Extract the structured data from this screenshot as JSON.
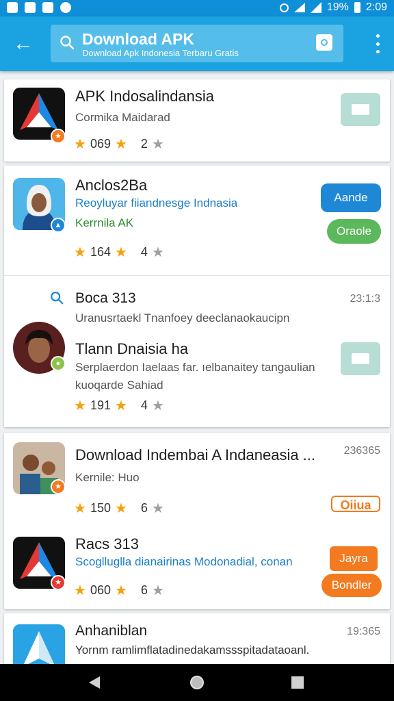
{
  "status_bar": {
    "battery": "19%",
    "time": "2:09"
  },
  "app_bar": {
    "search_title": "Download APK",
    "search_subtitle": "Download Apk Indonesia Terbaru Gratis"
  },
  "colors": {
    "accent": "#1aa3e0",
    "blue_button": "#1e88d6",
    "green_button": "#5cb85c",
    "orange_button": "#f37a1f",
    "star": "#f5a10a"
  },
  "list": [
    {
      "title": "APK Indosalindansia",
      "subtitle": "Cormika Maidarad",
      "rating": "069",
      "count": "2"
    },
    {
      "title": "Anclos2Ba",
      "subtitle": "Reoyluyar fiiandnesge Indnasia",
      "subtitle2": "Kerrnila AK",
      "rating": "164",
      "count": "4",
      "button1": "Aande",
      "button2": "Oraole"
    },
    {
      "title": "Boca 313",
      "time": "23:1:3",
      "subtitle": "Uranusrtaekl Tnanfoey deeclanaokaucipn"
    },
    {
      "title": "Tlann Dnaisia ha",
      "subtitle": "Serplaerdon Iaelaas far. ıelbanaitey tangaulian",
      "subtitle2": "kuoqarde Sahiad",
      "rating": "191",
      "count": "4"
    },
    {
      "title": "Download Indembai A Indaneasia ...",
      "time": "236365",
      "subtitle": "Kernile: Huo",
      "rating": "150",
      "count": "6",
      "tag": "Oiiua"
    },
    {
      "title": "Racs 313",
      "subtitle": "Scoglluglla dianairinas Modonadial, conan",
      "rating": "060",
      "count": "6",
      "button1": "Jayra",
      "button2": "Bondler"
    },
    {
      "title": "Anhaniblan",
      "time": "19:365",
      "subtitle": "Yornm ramlimflatadinedakamssspitadataoanl."
    }
  ]
}
